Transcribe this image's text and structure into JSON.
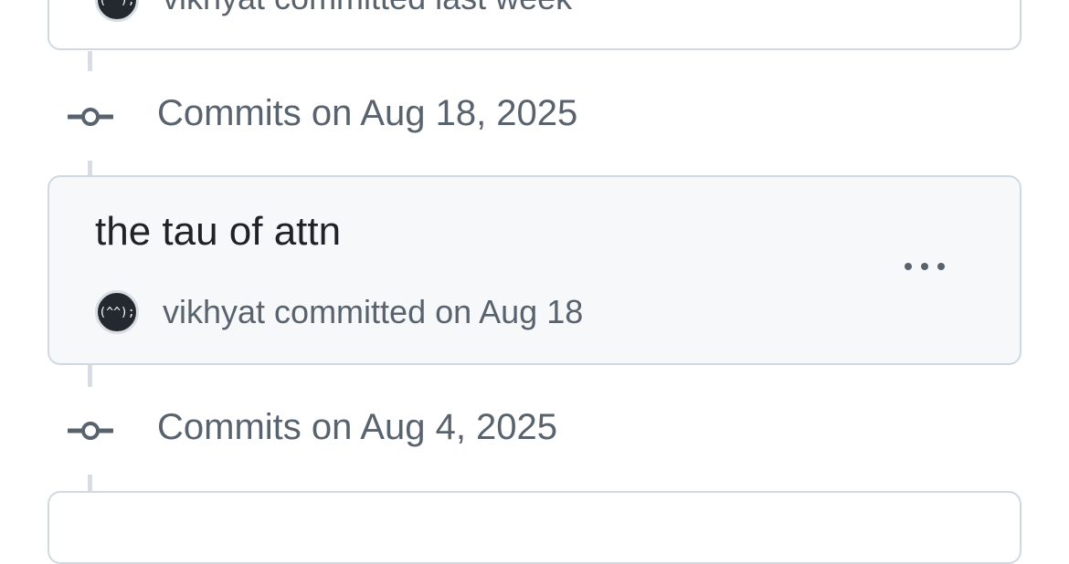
{
  "groups": [
    {
      "heading": "Commits on Aug 18, 2025"
    },
    {
      "heading": "Commits on Aug 4, 2025"
    }
  ],
  "previous_commit": {
    "meta_author": "vikhyat",
    "meta_text": " committed last week",
    "avatar_text": "(^^);"
  },
  "commit": {
    "title": "the tau of attn",
    "author": "vikhyat",
    "meta_text": " committed on Aug 18",
    "avatar_text": "(^^);"
  },
  "icons": {
    "commit_node": "git-commit-icon",
    "more_actions": "kebab-horizontal-icon"
  },
  "colors": {
    "text_primary": "#1f2328",
    "text_muted": "#59636e",
    "border": "#d1d9e0",
    "card_highlight_bg": "#f6f8fa",
    "timeline": "#d9dde3"
  }
}
